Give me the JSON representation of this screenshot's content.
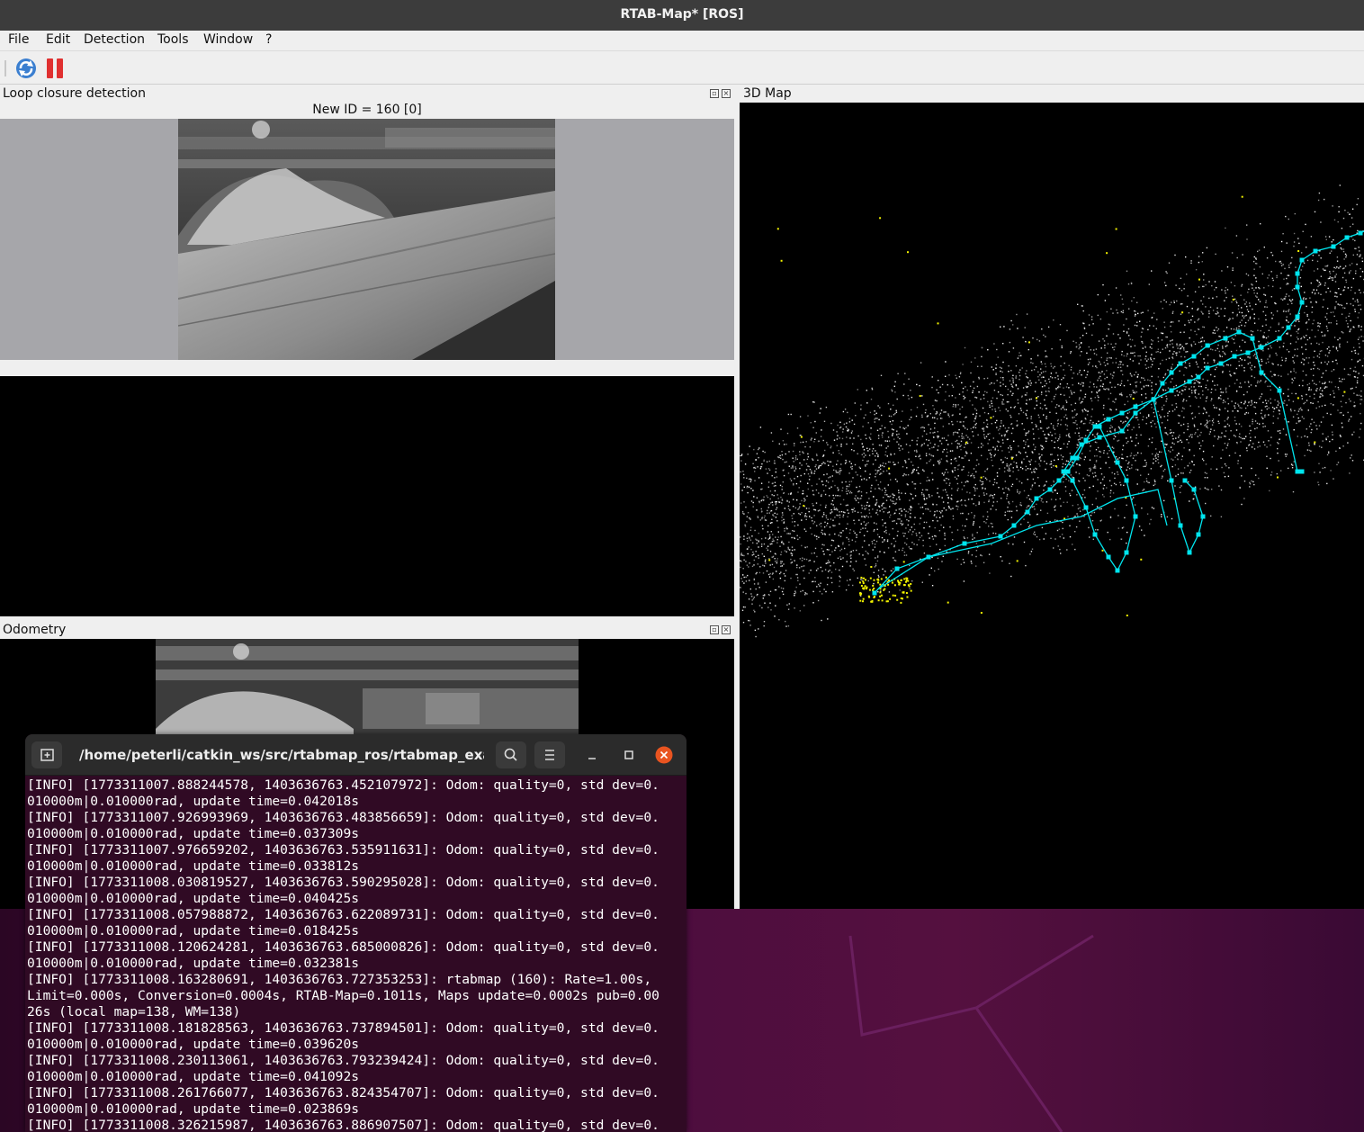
{
  "window": {
    "title": "RTAB-Map* [ROS]"
  },
  "menu": {
    "items": [
      "File",
      "Edit",
      "Detection",
      "Tools",
      "Window",
      "?"
    ]
  },
  "toolbar": {
    "refresh_icon": "refresh-icon",
    "pause_icon": "pause-icon"
  },
  "loop_panel": {
    "title": "Loop closure detection",
    "new_id_label": "New ID = 160 [0]"
  },
  "odom_panel": {
    "title": "Odometry"
  },
  "map_panel": {
    "title": "3D Map"
  },
  "colors": {
    "trajectory": "#00e5ee",
    "features": "#f2f200",
    "terminal_bg": "#300a24",
    "titlebar": "#3c3c3c"
  },
  "terminal": {
    "title": "/home/peterli/catkin_ws/src/rtabmap_ros/rtabmap_example...",
    "lines": [
      "[INFO] [1773311007.888244578, 1403636763.452107972]: Odom: quality=0, std dev=0.",
      "010000m|0.010000rad, update time=0.042018s",
      "[INFO] [1773311007.926993969, 1403636763.483856659]: Odom: quality=0, std dev=0.",
      "010000m|0.010000rad, update time=0.037309s",
      "[INFO] [1773311007.976659202, 1403636763.535911631]: Odom: quality=0, std dev=0.",
      "010000m|0.010000rad, update time=0.033812s",
      "[INFO] [1773311008.030819527, 1403636763.590295028]: Odom: quality=0, std dev=0.",
      "010000m|0.010000rad, update time=0.040425s",
      "[INFO] [1773311008.057988872, 1403636763.622089731]: Odom: quality=0, std dev=0.",
      "010000m|0.010000rad, update time=0.018425s",
      "[INFO] [1773311008.120624281, 1403636763.685000826]: Odom: quality=0, std dev=0.",
      "010000m|0.010000rad, update time=0.032381s",
      "[INFO] [1773311008.163280691, 1403636763.727353253]: rtabmap (160): Rate=1.00s,",
      "Limit=0.000s, Conversion=0.0004s, RTAB-Map=0.1011s, Maps update=0.0002s pub=0.00",
      "26s (local map=138, WM=138)",
      "[INFO] [1773311008.181828563, 1403636763.737894501]: Odom: quality=0, std dev=0.",
      "010000m|0.010000rad, update time=0.039620s",
      "[INFO] [1773311008.230113061, 1403636763.793239424]: Odom: quality=0, std dev=0.",
      "010000m|0.010000rad, update time=0.041092s",
      "[INFO] [1773311008.261766077, 1403636763.824354707]: Odom: quality=0, std dev=0.",
      "010000m|0.010000rad, update time=0.023869s",
      "[INFO] [1773311008.326215987, 1403636763.886907507]: Odom: quality=0, std dev=0."
    ]
  }
}
